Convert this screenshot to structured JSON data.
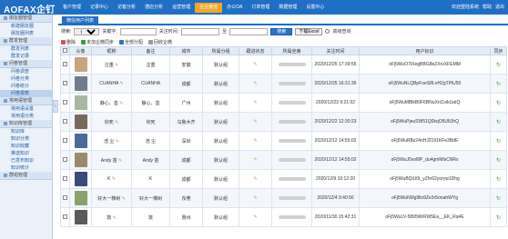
{
  "app": {
    "logo": "AOFAX企钉"
  },
  "nav": [
    "客户管理",
    "记录中心",
    "访客分析",
    "潜店分析",
    "运营管理",
    "企业微信",
    "办公OA",
    "订单管理",
    "数据管理",
    "设置中心"
  ],
  "nav_active_index": 5,
  "topright": {
    "welcome": "欢迎登陆系统",
    "a": "帮助",
    "b": "退出"
  },
  "sidebar": [
    {
      "title": "朋友圈管理",
      "items": [
        {
          "label": "新建朋友圈",
          "on": false
        },
        {
          "label": "朋友圈列表",
          "on": false
        }
      ]
    },
    {
      "title": "群发管理",
      "items": [
        {
          "label": "群发列表",
          "on": false
        },
        {
          "label": "群发记录",
          "on": false
        }
      ]
    },
    {
      "title": "问卷管理",
      "items": [
        {
          "label": "问卷调查",
          "on": false
        },
        {
          "label": "问卷分类",
          "on": false
        },
        {
          "label": "问卷统计",
          "on": false
        },
        {
          "label": "问卷报表",
          "on": true
        }
      ]
    },
    {
      "title": "常用语管理",
      "items": [
        {
          "label": "常用语设置",
          "on": false
        },
        {
          "label": "常用语分类",
          "on": false
        }
      ]
    },
    {
      "title": "知识库管理",
      "items": [
        {
          "label": "知识库",
          "on": false
        },
        {
          "label": "知识分类",
          "on": false
        },
        {
          "label": "知识收藏",
          "on": false
        },
        {
          "label": "推送知识",
          "on": false
        },
        {
          "label": "已发布知识",
          "on": false
        },
        {
          "label": "知识统计",
          "on": false
        }
      ]
    },
    {
      "title": "群组管理",
      "items": []
    }
  ],
  "tab": "微信用户列表",
  "filter": {
    "search_label": "搜索:",
    "search_select": "请选择",
    "keyword_label": "关键字:",
    "time_label": "关注时间:",
    "to_label": "至",
    "search_btn": "搜索",
    "export_btn": "下载Excel",
    "advanced_label": "高级查询"
  },
  "actions": [
    {
      "label": "删除",
      "icon": "delete-icon",
      "color": "#d9534f"
    },
    {
      "label": "未加企微同步",
      "icon": "sync-icon",
      "color": "#3a9a3a"
    },
    {
      "label": "全部分配",
      "icon": "assign-icon",
      "color": "#2a73c9"
    },
    {
      "label": "回收企微",
      "icon": "recycle-icon",
      "color": "#999999"
    }
  ],
  "columns": [
    "",
    "头像",
    "昵称",
    "备注",
    "城市",
    "所属分组",
    "跟进状态",
    "所属坐席",
    "关注时间",
    "用户标识",
    "同步"
  ],
  "rows": [
    {
      "nick": "注重",
      "remark": "注重",
      "city": "安徽",
      "group": "默认组",
      "time": "2020/12/25 17:39:55",
      "openid": "oFj5WuO7tXegBBG8eZXrvXFEMM",
      "avatar": "#c9a37a"
    },
    {
      "nick": "CUANHA",
      "remark": "CUANHA",
      "city": "成都",
      "group": "默认组",
      "time": "2020/12/25 16:31:36",
      "openid": "oFj5WuNLQBpFoeS8LnH2gTPiU50",
      "avatar": "#6f7d8c"
    },
    {
      "nick": "静心、善",
      "remark": "静心、善",
      "city": "广州",
      "group": "默认组",
      "time": "2020/12/23 9:21:02",
      "openid": "oFj5WuMBlkB0F6BNuXnCoikUaIQ",
      "avatar": "#a8b7a0"
    },
    {
      "nick": "欣死",
      "remark": "欣死",
      "city": "乌鲁木齐",
      "group": "默认组",
      "time": "2020/12/22 12:30:23",
      "openid": "oFj5WuPjeuSW51Q0kqO5U8JhQ",
      "avatar": "#7a6a5a"
    },
    {
      "nick": "浩 尘",
      "remark": "浩 尘",
      "city": "深圳",
      "group": "默认组",
      "time": "2020/12/12 14:55:02",
      "openid": "oFj5WuRBz24nHJ2191KFe3BdE",
      "avatar": "#4a6a9a"
    },
    {
      "nick": "Andy 苗",
      "remark": "Andy 苗",
      "city": "成都",
      "group": "默认组",
      "time": "2020/12/12 14:55:02",
      "openid": "oFj5WuJ0vol8P_du4gmMlsCNRs",
      "avatar": "#9a8b6a"
    },
    {
      "nick": "K",
      "remark": "K",
      "city": "成都",
      "group": "默认组",
      "time": "2020/12/9 10:12:20",
      "openid": "oFj5WuBQiU0t_yZhr62yoryw1Dhg",
      "avatar": "#3a4a7a"
    },
    {
      "nick": "好大一棵树",
      "remark": "好大一棵树",
      "city": "东莞",
      "group": "默认组",
      "time": "2020/12/4 9:40:56",
      "openid": "oFj5WuN9lg9llo9Ze3r5onahWYg",
      "avatar": "#8aa36a"
    },
    {
      "nick": "敦",
      "remark": "敦",
      "city": "惠州",
      "group": "默认组",
      "time": "2020/11/30 15:42:31",
      "openid": "oFj5WuLV-5895WrRW5Ea__EK_Rq4E",
      "avatar": "#5a5a5a"
    }
  ],
  "colors": {
    "brand": "#1f6fc4",
    "active_nav": "#f5a623"
  }
}
